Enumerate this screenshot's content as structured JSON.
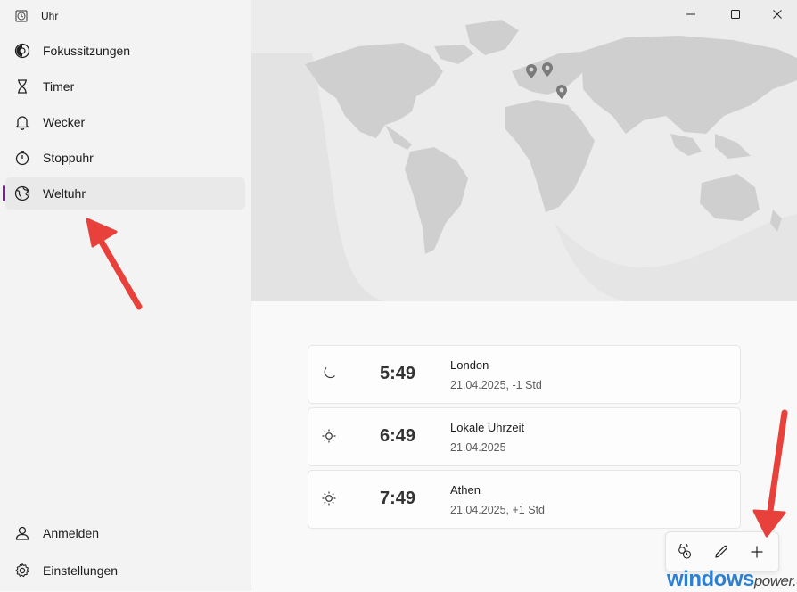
{
  "app": {
    "title": "Uhr",
    "icon": "clock-app-icon"
  },
  "sidebar": {
    "items": [
      {
        "label": "Fokussitzungen",
        "icon": "focus-icon"
      },
      {
        "label": "Timer",
        "icon": "hourglass-icon"
      },
      {
        "label": "Wecker",
        "icon": "bell-icon"
      },
      {
        "label": "Stoppuhr",
        "icon": "stopwatch-icon"
      },
      {
        "label": "Weltuhr",
        "icon": "globe-icon",
        "active": true
      }
    ],
    "footer": [
      {
        "label": "Anmelden",
        "icon": "person-icon"
      },
      {
        "label": "Einstellungen",
        "icon": "gear-icon"
      }
    ]
  },
  "clocks": [
    {
      "time": "5:49",
      "city": "London",
      "date": "21.04.2025, -1 Std",
      "icon": "moon-icon"
    },
    {
      "time": "6:49",
      "city": "Lokale Uhrzeit",
      "date": "21.04.2025",
      "icon": "sun-icon"
    },
    {
      "time": "7:49",
      "city": "Athen",
      "date": "21.04.2025, +1 Std",
      "icon": "sun-icon"
    }
  ],
  "toolbar": {
    "buttons": [
      "compare-icon",
      "edit-icon",
      "add-icon"
    ]
  },
  "watermark": {
    "main": "windows",
    "suffix": "power.de"
  },
  "colors": {
    "accent": "#7a1f8c",
    "arrow": "#e8403a",
    "watermark": "#2f7fd0"
  }
}
